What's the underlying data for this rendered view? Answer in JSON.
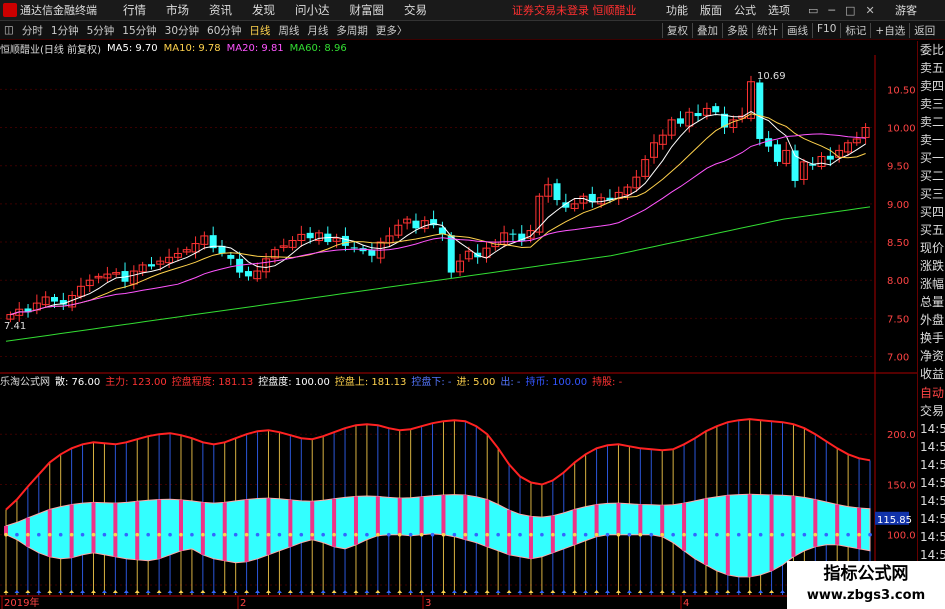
{
  "menubar": {
    "title": "通达信金融终端",
    "items": [
      "行情",
      "市场",
      "资讯",
      "发现",
      "问小达",
      "财富圈",
      "交易"
    ],
    "notice": "证券交易未登录  恒顺醋业",
    "right_items": [
      "功能",
      "版面",
      "公式",
      "选项"
    ],
    "window_controls": [
      "▭",
      "─",
      "□",
      "✕"
    ],
    "guest": "游客"
  },
  "tabbar": {
    "menu_icon": "◫",
    "tabs": [
      "分时",
      "1分钟",
      "5分钟",
      "15分钟",
      "30分钟",
      "60分钟",
      "日线",
      "周线",
      "月线",
      "多周期",
      "更多〉"
    ],
    "active_index": 6,
    "right_tabs": [
      "复权",
      "叠加",
      "多股",
      "统计",
      "画线",
      "F10",
      "标记",
      "+自选",
      "返回"
    ]
  },
  "infobar": {
    "stock": "恒顺醋业(日线 前复权)",
    "ma5": "MA5: 9.70",
    "ma10": "MA10: 9.78",
    "ma20": "MA20: 9.81",
    "ma60": "MA60: 8.96",
    "colors": {
      "ma5": "#ffffff",
      "ma10": "#ffd24d",
      "ma20": "#ff55ff",
      "ma60": "#33dd33"
    }
  },
  "indicator": {
    "name": "乐淘公式网",
    "items": [
      {
        "t": "散: 76.00",
        "c": "#ffffff"
      },
      {
        "t": "主力: 123.00",
        "c": "#ff3333"
      },
      {
        "t": "控盘程度: 181.13",
        "c": "#ff3333"
      },
      {
        "t": "控盘度: 100.00",
        "c": "#ffffff"
      },
      {
        "t": "控盘上: 181.13",
        "c": "#ffd24d"
      },
      {
        "t": "控盘下: -",
        "c": "#5577ff"
      },
      {
        "t": "进: 5.00",
        "c": "#ffd24d"
      },
      {
        "t": "出: -",
        "c": "#5577ff"
      },
      {
        "t": "持币: 100.00",
        "c": "#3355ff"
      },
      {
        "t": "持股: -",
        "c": "#ff3333"
      }
    ]
  },
  "panel": {
    "items": [
      "委比",
      "卖五",
      "卖四",
      "卖三",
      "卖二",
      "卖一",
      "买一",
      "买二",
      "买三",
      "买四",
      "买五",
      "现价",
      "涨跌",
      "涨幅",
      "总量",
      "外盘",
      "换手",
      "净资",
      "收益"
    ],
    "bottom": [
      "自动",
      "交易",
      "14:56",
      "14:56",
      "14:56",
      "14:56",
      "14:56",
      "14:56",
      "14:56",
      "14:56"
    ]
  },
  "watermark": {
    "line1": "指标公式网",
    "line2": "www.zbgs3.com"
  },
  "chart_data": {
    "type": "candlestick",
    "price_axis": {
      "ticks": [
        "10.50",
        "10.00",
        "9.50",
        "9.00",
        "8.50",
        "8.00",
        "7.50",
        "7.00"
      ],
      "ylim": [
        6.85,
        10.95
      ]
    },
    "annotations": {
      "high": "10.69",
      "low": "7.41"
    },
    "indicator_axis": {
      "ticks": [
        "200.0",
        "150.0",
        "100.0",
        "50.00"
      ],
      "ylim": [
        40,
        245
      ],
      "current": "115.85"
    },
    "x_labels": [
      "2019年",
      "2",
      "3",
      "4"
    ],
    "closes": [
      7.55,
      7.62,
      7.58,
      7.7,
      7.78,
      7.72,
      7.68,
      7.8,
      7.92,
      8.0,
      8.05,
      8.08,
      8.1,
      7.98,
      8.12,
      8.2,
      8.18,
      8.25,
      8.3,
      8.35,
      8.4,
      8.48,
      8.58,
      8.42,
      8.35,
      8.28,
      8.1,
      8.05,
      8.12,
      8.28,
      8.4,
      8.45,
      8.52,
      8.6,
      8.55,
      8.62,
      8.5,
      8.55,
      8.45,
      8.42,
      8.38,
      8.32,
      8.5,
      8.58,
      8.72,
      8.8,
      8.68,
      8.78,
      8.72,
      8.6,
      8.1,
      8.25,
      8.38,
      8.3,
      8.42,
      8.5,
      8.62,
      8.6,
      8.52,
      8.65,
      9.1,
      9.25,
      9.05,
      8.95,
      9.0,
      9.1,
      9.02,
      9.08,
      9.05,
      9.15,
      9.22,
      9.35,
      9.58,
      9.8,
      9.9,
      10.1,
      10.05,
      10.2,
      10.15,
      10.25,
      10.2,
      10.0,
      10.1,
      10.15,
      10.6,
      9.85,
      9.75,
      9.55,
      9.7,
      9.3,
      9.55,
      9.5,
      9.62,
      9.58,
      9.7,
      9.8,
      9.85,
      10.0
    ],
    "ma60": [
      7.2,
      7.22,
      7.24,
      7.26,
      7.28,
      7.3,
      7.32,
      7.34,
      7.36,
      7.38,
      7.4,
      7.42,
      7.44,
      7.46,
      7.48,
      7.5,
      7.52,
      7.54,
      7.56,
      7.58,
      7.6,
      7.62,
      7.64,
      7.66,
      7.68,
      7.7,
      7.72,
      7.74,
      7.76,
      7.78,
      7.8,
      7.82,
      7.84,
      7.86,
      7.88,
      7.9,
      7.92,
      7.94,
      7.96,
      7.98,
      8.0,
      8.02,
      8.04,
      8.06,
      8.08,
      8.1,
      8.12,
      8.14,
      8.16,
      8.18,
      8.2,
      8.22,
      8.24,
      8.26,
      8.28,
      8.3,
      8.32,
      8.35,
      8.38,
      8.41,
      8.44,
      8.47,
      8.5,
      8.53,
      8.56,
      8.59,
      8.62,
      8.65,
      8.68,
      8.71,
      8.74,
      8.77,
      8.8,
      8.82,
      8.84,
      8.86,
      8.88,
      8.9,
      8.92,
      8.94,
      8.96
    ],
    "indicator_upper": [
      125,
      135,
      148,
      160,
      172,
      180,
      186,
      190,
      192,
      191,
      190,
      192,
      195,
      198,
      200,
      201,
      199,
      196,
      192,
      190,
      192,
      196,
      200,
      203,
      204,
      202,
      199,
      196,
      195,
      198,
      202,
      206,
      209,
      210,
      209,
      206,
      204,
      205,
      208,
      211,
      213,
      214,
      213,
      208,
      200,
      186,
      170,
      158,
      152,
      150,
      154,
      162,
      172,
      180,
      186,
      189,
      190,
      188,
      186,
      185,
      184,
      185,
      190,
      196,
      203,
      208,
      212,
      214,
      215,
      214,
      213,
      212,
      210,
      206,
      200,
      193,
      186,
      180,
      176,
      174
    ],
    "indicator_lower": [
      100,
      95,
      88,
      82,
      78,
      76,
      77,
      80,
      82,
      80,
      78,
      76,
      75,
      74,
      76,
      80,
      84,
      86,
      80,
      76,
      74,
      72,
      73,
      76,
      80,
      84,
      88,
      92,
      95,
      92,
      88,
      86,
      90,
      95,
      99,
      100,
      100,
      99,
      100,
      101,
      100,
      98,
      95,
      92,
      88,
      84,
      80,
      78,
      76,
      78,
      82,
      86,
      90,
      94,
      98,
      100,
      100,
      100,
      100,
      100,
      98,
      92,
      84,
      76,
      70,
      64,
      60,
      58,
      58,
      60,
      64,
      70,
      78,
      84,
      88,
      90,
      90,
      88,
      86,
      84
    ]
  }
}
